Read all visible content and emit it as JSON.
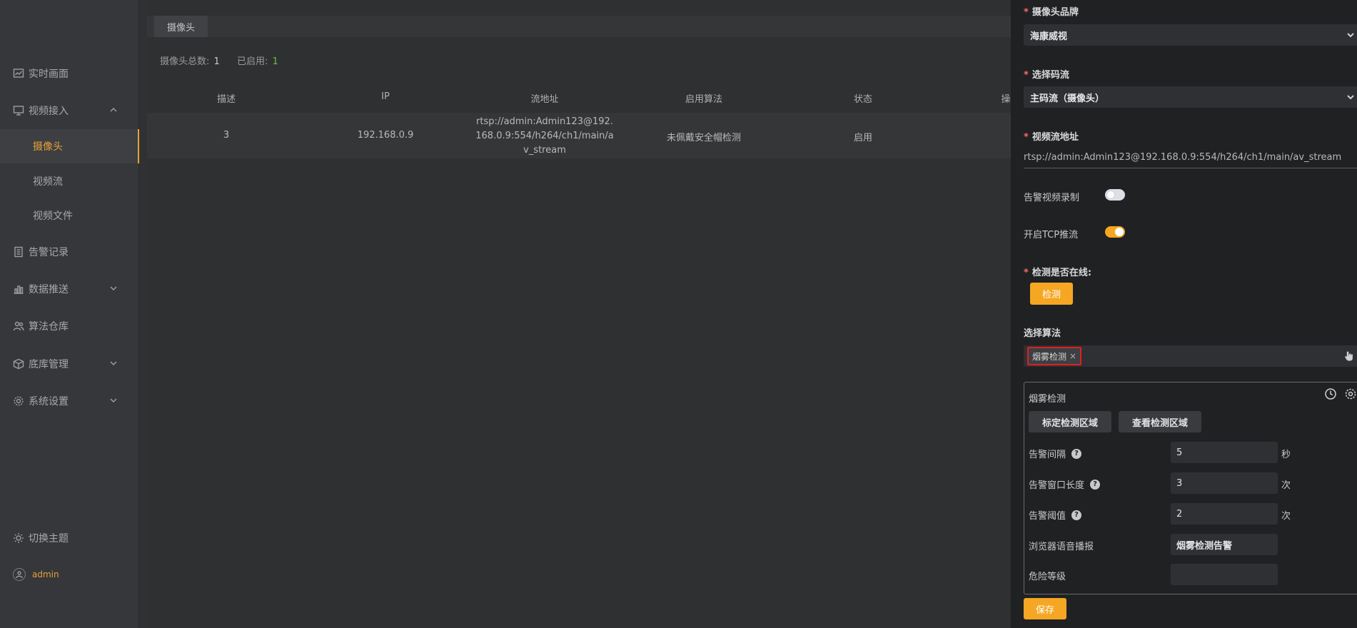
{
  "sidebar": {
    "items": [
      {
        "label": "实时画面",
        "icon": "chart-icon"
      },
      {
        "label": "视频接入",
        "icon": "monitor-icon"
      },
      {
        "label": "摄像头"
      },
      {
        "label": "视频流"
      },
      {
        "label": "视频文件"
      },
      {
        "label": "告警记录",
        "icon": "document-icon"
      },
      {
        "label": "数据推送",
        "icon": "bar-chart-icon"
      },
      {
        "label": "算法仓库",
        "icon": "users-icon"
      },
      {
        "label": "底库管理",
        "icon": "box-icon"
      },
      {
        "label": "系统设置",
        "icon": "gear-icon"
      }
    ],
    "theme_label": "切换主题",
    "user_label": "admin"
  },
  "main": {
    "tab_label": "摄像头",
    "stats": {
      "total_label": "摄像头总数:",
      "total_value": "1",
      "enabled_label": "已启用:",
      "enabled_value": "1"
    },
    "table": {
      "headers": [
        "描述",
        "IP",
        "流地址",
        "启用算法",
        "状态",
        "操"
      ],
      "rows": [
        {
          "desc": "3",
          "ip": "192.168.0.9",
          "stream_line1": "rtsp://admin:Admin123@192.",
          "stream_line2": "168.0.9:554/h264/ch1/main/a",
          "stream_line3": "v_stream",
          "algo": "未佩戴安全帽检测",
          "status": "启用"
        }
      ]
    }
  },
  "panel": {
    "brand": {
      "label": "摄像头品牌",
      "value": "海康威视"
    },
    "stream_type": {
      "label": "选择码流",
      "value": "主码流（摄像头）"
    },
    "stream_url": {
      "label": "视频流地址",
      "value": "rtsp://admin:Admin123@192.168.0.9:554/h264/ch1/main/av_stream"
    },
    "alarm_record": {
      "label": "告警视频录制",
      "enabled": false
    },
    "tcp_push": {
      "label": "开启TCP推流",
      "enabled": true
    },
    "online_check": {
      "label": "检测是否在线:",
      "button": "检测"
    },
    "algorithm": {
      "label": "选择算法",
      "selected_tag": "烟雾检测",
      "config": {
        "title": "烟雾检测",
        "btn_set_area": "标定检测区域",
        "btn_view_area": "查看检测区域",
        "alarm_interval": {
          "label": "告警间隔",
          "value": "5",
          "unit": "秒"
        },
        "alarm_window": {
          "label": "告警窗口长度",
          "value": "3",
          "unit": "次"
        },
        "alarm_threshold": {
          "label": "告警阈值",
          "value": "2",
          "unit": "次"
        },
        "voice_broadcast": {
          "label": "浏览器语音播报",
          "value": "烟雾检测告警"
        },
        "danger_level": {
          "label": "危险等级",
          "value": ""
        }
      }
    },
    "save_button": "保存"
  },
  "colors": {
    "accent": "#f5a623",
    "active_nav": "#e8a13a",
    "required": "#f56c6c",
    "highlight_border": "#e02020",
    "enabled_count": "#67c23a"
  }
}
